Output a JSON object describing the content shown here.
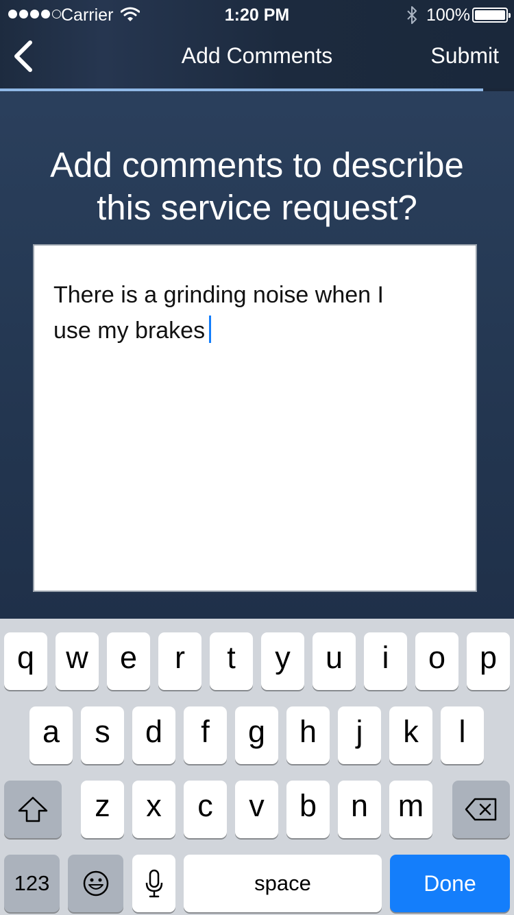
{
  "status_bar": {
    "carrier": "Carrier",
    "time": "1:20 PM",
    "battery": "100%"
  },
  "nav": {
    "back_icon": "chevron-left-icon",
    "title": "Add Comments",
    "submit_label": "Submit",
    "progress_fraction": 0.94
  },
  "prompt": {
    "line1": "Add comments to describe",
    "line2": "this service request?"
  },
  "comment": {
    "text": "There is a grinding noise when I\nuse my brakes"
  },
  "keyboard": {
    "row1": [
      "q",
      "w",
      "e",
      "r",
      "t",
      "y",
      "u",
      "i",
      "o",
      "p"
    ],
    "row2": [
      "a",
      "s",
      "d",
      "f",
      "g",
      "h",
      "j",
      "k",
      "l"
    ],
    "row3": [
      "z",
      "x",
      "c",
      "v",
      "b",
      "n",
      "m"
    ],
    "numbers_label": "123",
    "space_label": "space",
    "done_label": "Done"
  },
  "colors": {
    "accent": "#147efb",
    "background": "#2a3d57",
    "keyboard_bg": "#d1d5db"
  }
}
